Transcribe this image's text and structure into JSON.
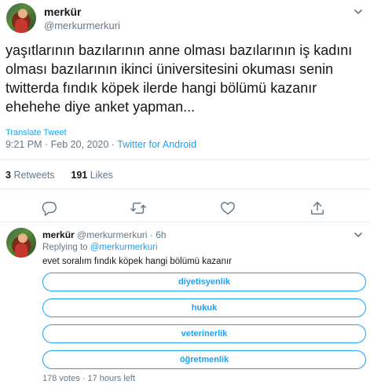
{
  "tweet": {
    "name": "merkür",
    "handle": "@merkurmerkuri",
    "text": "yaşıtlarının bazılarının anne olması bazılarının iş kadını olması bazılarının ikinci üniversitesini okuması senin twitterda fındık köpek ilerde hangi bölümü kazanır ehehehe diye anket yapman...",
    "translate": "Translate Tweet",
    "time": "9:21 PM · Feb 20, 2020 · ",
    "source": "Twitter for Android",
    "retweets": "3",
    "retweets_label": "Retweets",
    "likes": "191",
    "likes_label": "Likes"
  },
  "actions": {
    "reply_icon": "reply-icon",
    "retweet_icon": "retweet-icon",
    "like_icon": "heart-icon",
    "share_icon": "share-icon"
  },
  "reply": {
    "name": "merkür",
    "handle_time": "@merkurmerkuri · 6h",
    "replying_prefix": "Replying to",
    "replying_to": "@merkurmerkuri",
    "text": "evet soralım fındık köpek hangi bölümü kazanır",
    "poll": {
      "options": [
        "diyetisyenlik",
        "hukuk",
        "veterinerlik",
        "öğretmenlik"
      ],
      "footer": "178 votes · 17 hours left"
    }
  },
  "colors": {
    "accent": "#1da1f2",
    "muted": "#657786",
    "text": "#14171a",
    "divider": "#e6ecf0"
  }
}
